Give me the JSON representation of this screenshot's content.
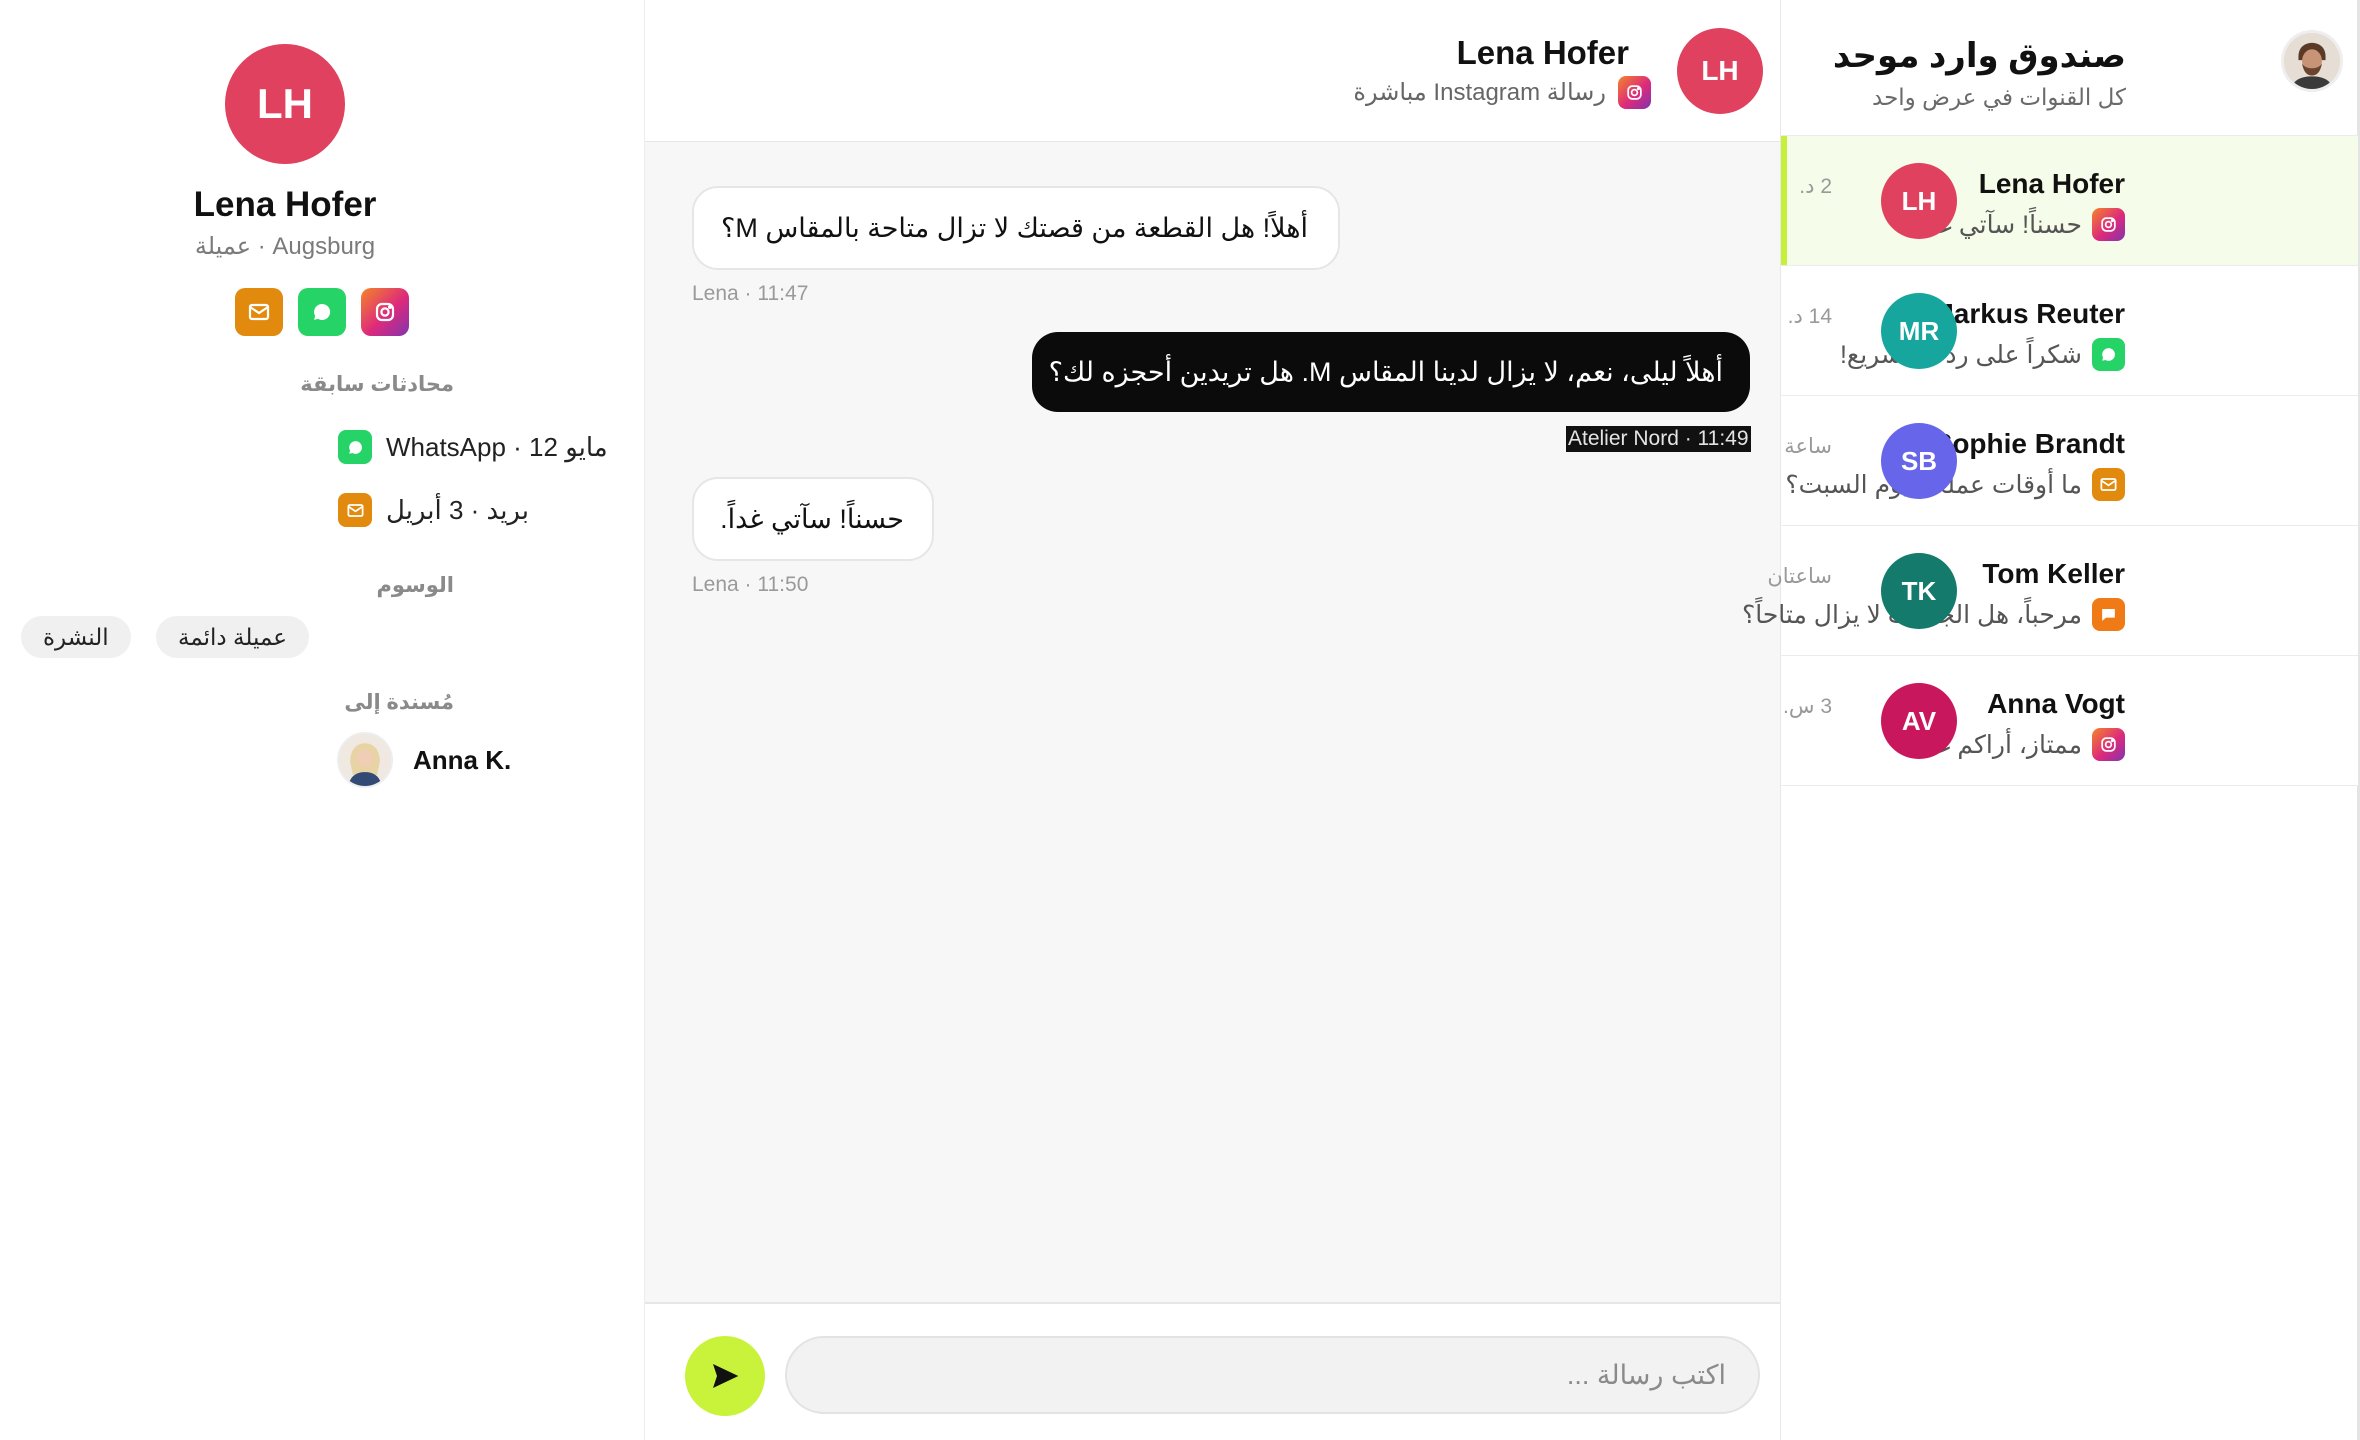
{
  "inbox": {
    "title": "صندوق وارد موحد",
    "subtitle": "كل القنوات في عرض واحد",
    "conversations": [
      {
        "initials": "LH",
        "name": "Lena Hofer",
        "preview": "حسناً! سآتي غداً.",
        "time": "2 د.",
        "channel": "instagram-icon",
        "avatar_color": "#e0415f",
        "active": true
      },
      {
        "initials": "MR",
        "name": "Markus Reuter",
        "preview": "شكراً على ردك السريع!",
        "time": "14 د.",
        "channel": "whatsapp-icon",
        "avatar_color": "#17a69d",
        "active": false
      },
      {
        "initials": "SB",
        "name": "Sophie Brandt",
        "preview": "ما أوقات عملكم يوم السبت؟",
        "time": "ساعة",
        "channel": "mail-icon",
        "avatar_color": "#6766ea",
        "active": false
      },
      {
        "initials": "TK",
        "name": "Tom Keller",
        "preview": "مرحباً، هل الجاكيت لا يزال متاحاً؟",
        "time": "ساعتان",
        "channel": "message-icon",
        "avatar_color": "#137a6c",
        "active": false
      },
      {
        "initials": "AV",
        "name": "Anna Vogt",
        "preview": "ممتاز، أراكم غداً!",
        "time": "3 س.",
        "channel": "instagram-icon",
        "avatar_color": "#c9175e",
        "active": false
      }
    ]
  },
  "chat": {
    "header": {
      "initials": "LH",
      "name": "Lena Hofer",
      "subtitle": "رسالة Instagram مباشرة"
    },
    "messages": [
      {
        "direction": "in",
        "text": "أهلاً! هل القطعة من قصتك لا تزال متاحة بالمقاس M؟",
        "meta": "Lena · 11:47"
      },
      {
        "direction": "out",
        "text": "أهلاً ليلى، نعم، لا يزال لدينا المقاس M. هل تريدين أحجزه لك؟",
        "meta": "Atelier Nord · 11:49"
      },
      {
        "direction": "in",
        "text": "حسناً! سآتي غداً.",
        "meta": "Lena · 11:50"
      }
    ],
    "composer": {
      "placeholder": "اكتب رسالة ..."
    }
  },
  "contact": {
    "initials": "LH",
    "name": "Lena Hofer",
    "subtitle": "Augsburg · عميلة",
    "channels": [
      "mail-icon",
      "whatsapp-icon",
      "instagram-icon"
    ],
    "past_title": "محادثات سابقة",
    "past": [
      {
        "channel": "whatsapp-icon",
        "label": "WhatsApp · 12 مايو"
      },
      {
        "channel": "mail-icon",
        "label": "بريد · 3 أبريل"
      }
    ],
    "tags_title": "الوسوم",
    "tags": [
      "عميلة دائمة",
      "النشرة"
    ],
    "assigned_title": "مُسندة إلى",
    "assignee": "Anna K."
  },
  "colors": {
    "accent": "#c6f03a",
    "active_row": "#f5fce9",
    "outgoing_bubble": "#0b0b0b",
    "instagram": "#dd2a7b",
    "whatsapp": "#25d366",
    "mail": "#e28a0e"
  }
}
